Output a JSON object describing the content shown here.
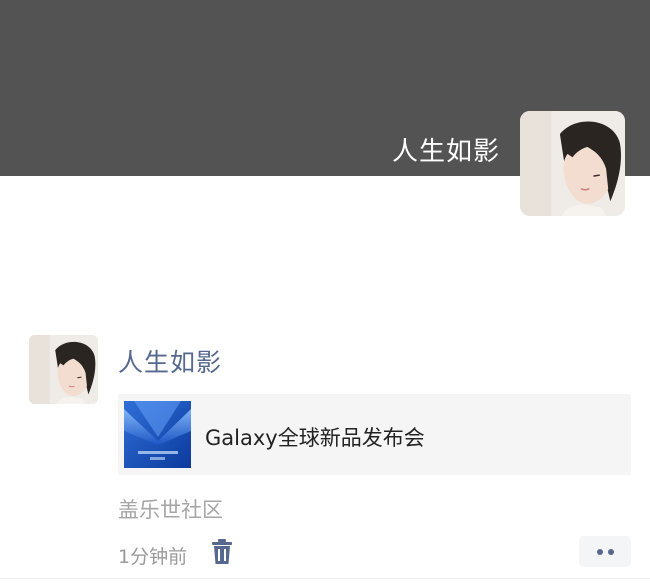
{
  "cover": {
    "user_name": "人生如影"
  },
  "post": {
    "author": "人生如影",
    "link": {
      "title": "Galaxy全球新品发布会"
    },
    "source": "盖乐世社区",
    "time": "1分钟前"
  },
  "icons": {
    "delete": "trash-icon",
    "more": "more-dots-icon"
  },
  "colors": {
    "cover_bg": "#535353",
    "name_link": "#56688f",
    "card_bg": "#f5f5f5",
    "muted_text": "#a5a5a5"
  }
}
